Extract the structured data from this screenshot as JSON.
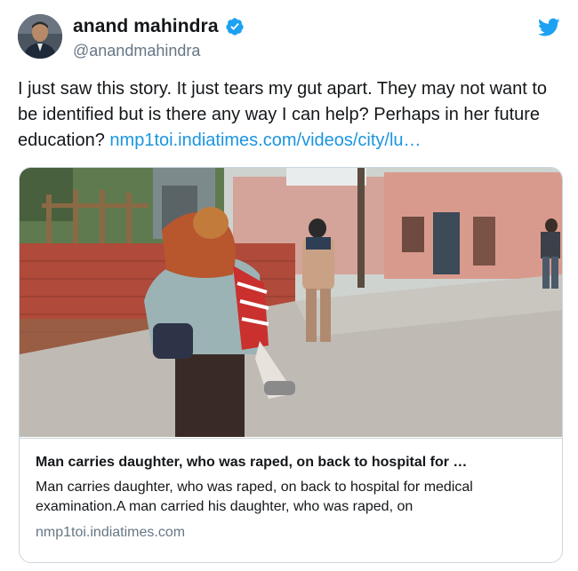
{
  "author": {
    "display_name": "anand mahindra",
    "handle": "@anandmahindra",
    "verified": true,
    "avatar_icon": "profile-photo",
    "verified_icon": "verified-badge-icon"
  },
  "platform_icon": "twitter-bird-icon",
  "tweet": {
    "text": "I just saw this story. It just tears my gut apart. They may not want to be identified but is there any way I can help? Perhaps in her future education? ",
    "link": "nmp1toi.indiatimes.com/videos/city/lu…"
  },
  "card": {
    "title": "Man carries daughter, who was raped, on back to hospital for …",
    "description": "Man carries daughter, who was raped, on back to hospital for medical examination.A man carried his daughter, who was raped, on",
    "domain": "nmp1toi.indiatimes.com"
  },
  "colors": {
    "link": "#1b95e0",
    "verified": "#1da1f2",
    "secondary_text": "#657786",
    "border": "#ccd6dd"
  }
}
